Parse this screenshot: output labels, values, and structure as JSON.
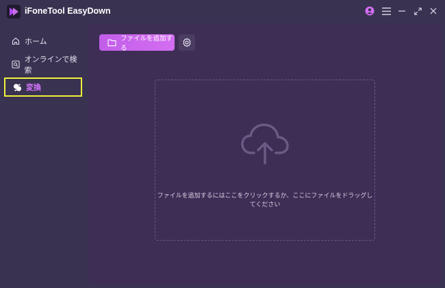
{
  "app": {
    "title": "iFoneTool EasyDown",
    "logo_icon": "app-logo-icon"
  },
  "window_controls": [
    {
      "name": "user-icon",
      "label": "user account"
    },
    {
      "name": "menu-icon",
      "label": "menu"
    },
    {
      "name": "minimize-icon",
      "label": "minimize"
    },
    {
      "name": "maximize-icon",
      "label": "maximize"
    },
    {
      "name": "close-icon",
      "label": "close"
    }
  ],
  "sidebar": {
    "items": [
      {
        "label": "ホーム",
        "icon": "home-icon",
        "active": false
      },
      {
        "label": "オンラインで検索",
        "icon": "search-icon",
        "active": false
      },
      {
        "label": "変換",
        "icon": "convert-icon",
        "active": true
      }
    ]
  },
  "main": {
    "add_file_label": "ファイルを追加する",
    "add_file_icon": "folder-icon",
    "settings_icon": "gear-icon",
    "drop_icon": "cloud-upload-icon",
    "drop_hint": "ファイルを追加するにはここをクリックするか、ここにファイルをドラッグしてください"
  },
  "colors": {
    "background": "#3a3251",
    "panel": "#3e2e56",
    "accent": "#d46ef2",
    "active_text": "#d676ff",
    "highlight_border": "#f1f23b"
  }
}
